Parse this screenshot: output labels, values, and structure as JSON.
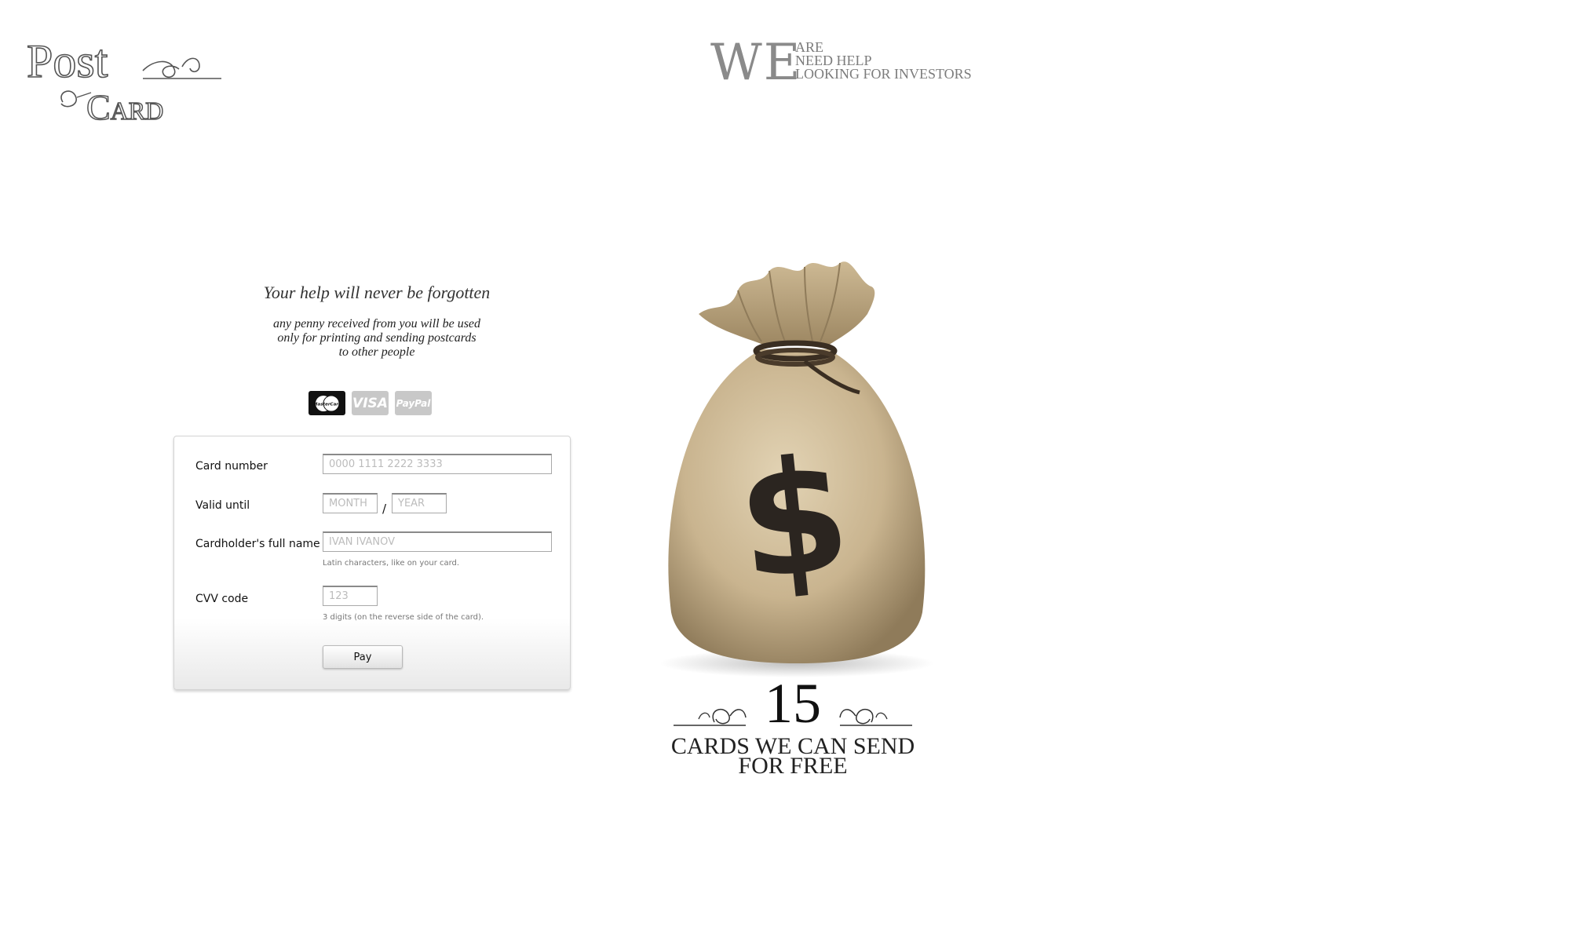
{
  "logo": {
    "word1": "Post",
    "word2": "Card"
  },
  "header": {
    "big_word": "WE",
    "lines": [
      "ARE",
      "NEED HELP",
      "LOOKING FOR INVESTORS"
    ]
  },
  "intro": {
    "headline": "Your help will never be forgotten",
    "subtext": [
      "any penny received from you will be used",
      "only for printing and sending postcards",
      "to other people"
    ]
  },
  "payment_methods": [
    {
      "name": "MasterCard",
      "icon": "mastercard-icon"
    },
    {
      "name": "VISA",
      "icon": "visa-icon"
    },
    {
      "name": "PayPal",
      "icon": "paypal-icon"
    }
  ],
  "form": {
    "card_number": {
      "label": "Card number",
      "placeholder": "0000 1111 2222 3333"
    },
    "valid_until": {
      "label": "Valid until",
      "month_placeholder": "MONTH",
      "year_placeholder": "YEAR",
      "separator": "/"
    },
    "cardholder": {
      "label": "Cardholder's full name",
      "placeholder": "IVAN IVANOV",
      "hint": "Latin characters, like on your card."
    },
    "cvv": {
      "label": "CVV code",
      "placeholder": "123",
      "hint": "3 digits (on the reverse side of the card)."
    },
    "pay_button": "Pay"
  },
  "counter": {
    "number": "15",
    "caption_line1": "CARDS WE CAN SEND",
    "caption_line2": "FOR FREE"
  },
  "colors": {
    "bag_fabric": "#c9b48f",
    "bag_shadow": "#8f7b5a",
    "dollar_sign": "#2b2520",
    "logo_ink": "#555555"
  }
}
